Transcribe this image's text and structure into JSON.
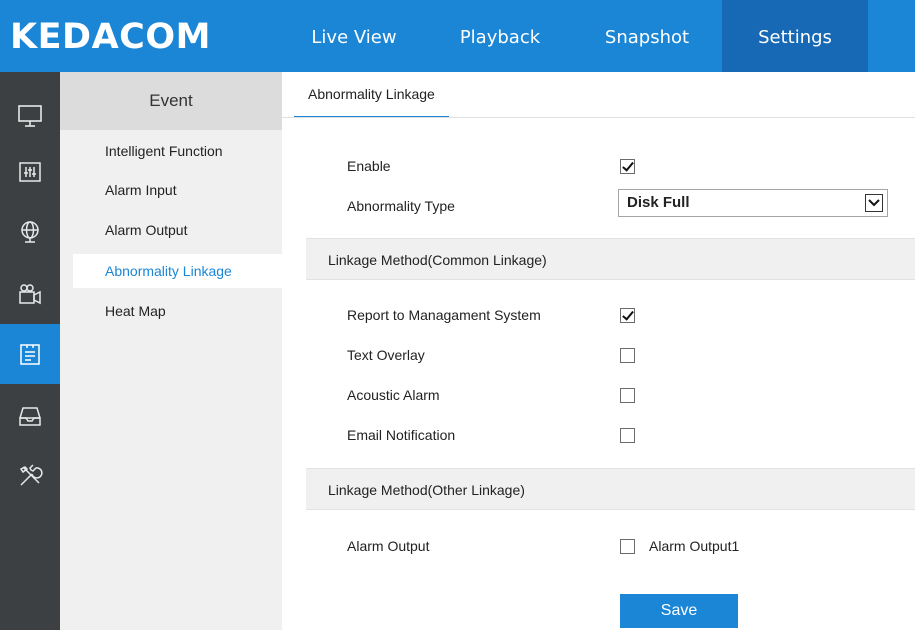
{
  "brand": {
    "logo": "KEDACOM"
  },
  "topnav": {
    "tabs": [
      {
        "label": "Live View"
      },
      {
        "label": "Playback"
      },
      {
        "label": "Snapshot"
      },
      {
        "label": "Settings"
      }
    ],
    "active": "Settings"
  },
  "iconbar": {
    "items": [
      "monitor-icon",
      "adjust-icon",
      "network-icon",
      "camera-icon",
      "event-icon",
      "storage-icon",
      "tools-icon"
    ],
    "active": "event-icon"
  },
  "leftnav": {
    "header": "Event",
    "items": [
      {
        "label": "Intelligent Function"
      },
      {
        "label": "Alarm Input"
      },
      {
        "label": "Alarm Output"
      },
      {
        "label": "Abnormality Linkage"
      },
      {
        "label": "Heat Map"
      }
    ],
    "active": "Abnormality Linkage"
  },
  "subtab": {
    "label": "Abnormality Linkage"
  },
  "form": {
    "enable": {
      "label": "Enable",
      "checked": true
    },
    "abnormality_type": {
      "label": "Abnormality Type",
      "value": "Disk Full"
    },
    "common_section": "Linkage Method(Common Linkage)",
    "report": {
      "label": "Report to Managament System",
      "checked": true
    },
    "text_overlay": {
      "label": "Text Overlay",
      "checked": false
    },
    "acoustic": {
      "label": "Acoustic Alarm",
      "checked": false
    },
    "email": {
      "label": "Email Notification",
      "checked": false
    },
    "other_section": "Linkage Method(Other Linkage)",
    "alarm_output": {
      "label": "Alarm Output",
      "option": "Alarm Output1",
      "checked": false
    },
    "save_label": "Save"
  },
  "colors": {
    "accent": "#1b86d6",
    "active_tab": "#1768b5",
    "iconbar": "#3c4043"
  }
}
